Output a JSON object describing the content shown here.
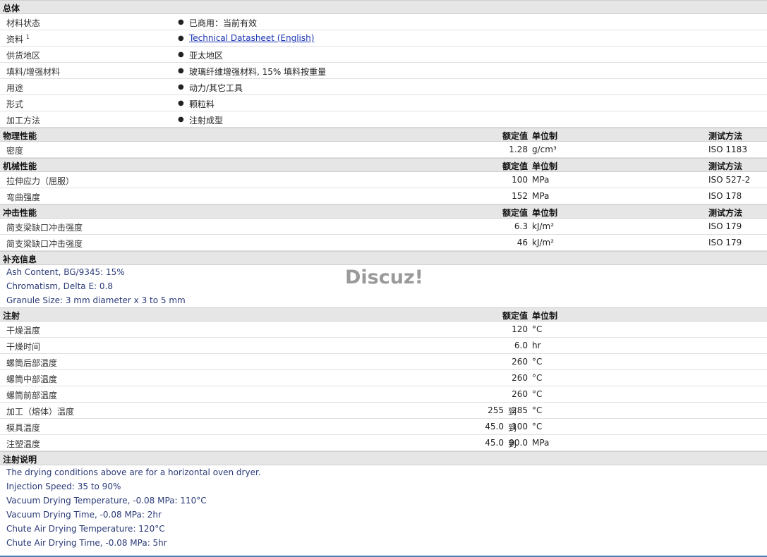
{
  "watermark": "Discuz!",
  "general": {
    "title": "总体",
    "rows": [
      {
        "label": "材料状态",
        "value": "已商用：当前有效"
      },
      {
        "label": "资料",
        "sup": "1",
        "value": "Technical Datasheet (English)",
        "link": true
      },
      {
        "label": "供货地区",
        "value": "亚太地区"
      },
      {
        "label": "填料/增强材料",
        "value": "玻璃纤维增强材料, 15% 填料按重量"
      },
      {
        "label": "用途",
        "value": "动力/其它工具"
      },
      {
        "label": "形式",
        "value": "颗粒料"
      },
      {
        "label": "加工方法",
        "value": "注射成型"
      }
    ]
  },
  "headers": {
    "nominal": "额定值",
    "unit": "单位制",
    "test": "测试方法"
  },
  "physical": {
    "title": "物理性能",
    "rows": [
      {
        "label": "密度",
        "value": "1.28",
        "unit": "g/cm³",
        "test": "ISO 1183"
      }
    ]
  },
  "mechanical": {
    "title": "机械性能",
    "rows": [
      {
        "label": "拉伸应力（屈服）",
        "value": "100",
        "unit": "MPa",
        "test": "ISO 527-2"
      },
      {
        "label": "弯曲强度",
        "value": "152",
        "unit": "MPa",
        "test": "ISO 178"
      }
    ]
  },
  "impact": {
    "title": "冲击性能",
    "rows": [
      {
        "label": "简支梁缺口冲击强度",
        "value": "6.3",
        "unit": "kJ/m²",
        "test": "ISO 179"
      },
      {
        "label": "简支梁缺口冲击强度",
        "value": "46",
        "unit": "kJ/m²",
        "test": "ISO 179"
      }
    ]
  },
  "supplementary": {
    "title": "补充信息",
    "lines": [
      "Ash Content, BG/9345: 15%",
      "Chromatism, Delta E: 0.8",
      "Granule Size: 3 mm diameter x 3 to 5 mm"
    ]
  },
  "injection": {
    "title": "注射",
    "rows": [
      {
        "label": "干燥温度",
        "value": "120",
        "unit": "°C"
      },
      {
        "label": "干燥时间",
        "value": "6.0",
        "unit": "hr"
      },
      {
        "label": "螺筒后部温度",
        "value": "260",
        "unit": "°C"
      },
      {
        "label": "螺筒中部温度",
        "value": "260",
        "unit": "°C"
      },
      {
        "label": "螺筒前部温度",
        "value": "260",
        "unit": "°C"
      },
      {
        "label": "加工（熔体）温度",
        "low": "255",
        "to": "到",
        "high": "285",
        "unit": "°C"
      },
      {
        "label": "模具温度",
        "low": "45.0",
        "to": "到",
        "high": "100",
        "unit": "°C"
      },
      {
        "label": "注塑温度",
        "low": "45.0",
        "to": "到",
        "high": "90.0",
        "unit": "MPa"
      }
    ]
  },
  "injection_notes": {
    "title": "注射说明",
    "lines": [
      "The drying conditions above are for a horizontal oven dryer.",
      "Injection Speed: 35 to 90%",
      "Vacuum Drying Temperature, -0.08 MPa: 110°C",
      "Vacuum Drying Time, -0.08 MPa: 2hr",
      "Chute Air Drying Temperature: 120°C",
      "Chute Air Drying Time, -0.08 MPa: 5hr"
    ]
  }
}
